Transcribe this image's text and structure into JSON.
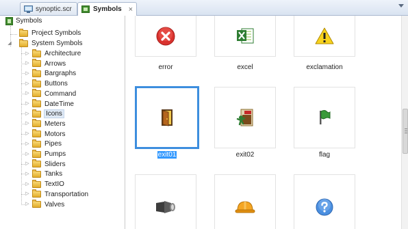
{
  "tabs": [
    {
      "label": "synoptic.scr",
      "active": false,
      "icon": "screen-icon"
    },
    {
      "label": "Symbols",
      "active": true,
      "icon": "symbols-icon",
      "close": "×"
    }
  ],
  "tree": {
    "root": "Symbols",
    "children": [
      "Project Symbols",
      "System Symbols"
    ],
    "system_symbols": [
      "Architecture",
      "Arrows",
      "Bargraphs",
      "Buttons",
      "Command",
      "DateTime",
      "Icons",
      "Meters",
      "Motors",
      "Pipes",
      "Pumps",
      "Sliders",
      "Tanks",
      "TextIO",
      "Transportation",
      "Valves"
    ],
    "selected": "Icons"
  },
  "symbols": [
    {
      "label": "error",
      "icon": "error-icon"
    },
    {
      "label": "excel",
      "icon": "excel-icon"
    },
    {
      "label": "exclamation",
      "icon": "exclamation-icon"
    },
    {
      "label": "exit01",
      "icon": "exit01-icon",
      "selected": true
    },
    {
      "label": "exit02",
      "icon": "exit02-icon"
    },
    {
      "label": "flag",
      "icon": "flag-icon"
    },
    {
      "label": "",
      "icon": "flashlight-icon"
    },
    {
      "label": "",
      "icon": "hardhat-icon"
    },
    {
      "label": "",
      "icon": "help-icon"
    }
  ],
  "colors": {
    "selection": "#3d8ede",
    "label_highlight": "#3399ff"
  }
}
